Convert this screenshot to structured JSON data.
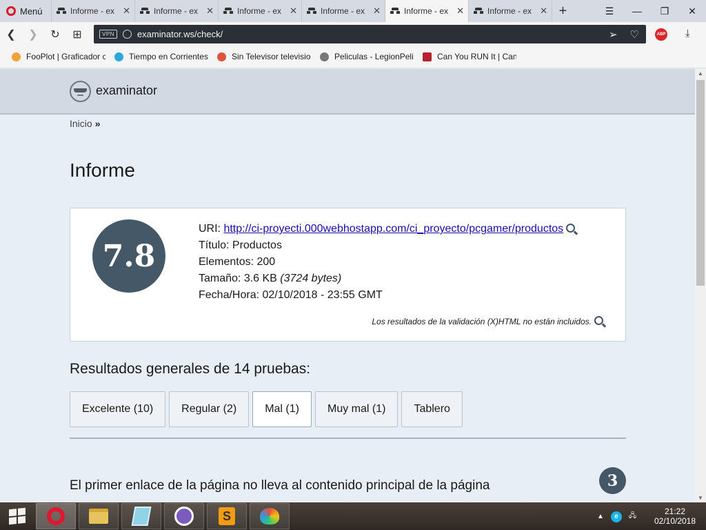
{
  "browser": {
    "menu_label": "Menú",
    "tabs": [
      {
        "label": "Informe - ex"
      },
      {
        "label": "Informe - ex"
      },
      {
        "label": "Informe - ex"
      },
      {
        "label": "Informe - ex"
      },
      {
        "label": "Informe - ex"
      },
      {
        "label": "Informe - ex"
      }
    ],
    "active_tab": 4,
    "url": "examinator.ws/check/",
    "vpn_label": "VPN",
    "abp_label": "ABP",
    "bookmarks": [
      {
        "label": "FooPlot | Graficador c",
        "icon": "fooplot-icon",
        "color": "#f2a23a"
      },
      {
        "label": "Tiempo en Corrientes",
        "icon": "weather-icon",
        "color": "#2ba6de"
      },
      {
        "label": "Sin Televisor televisio",
        "icon": "gear-icon",
        "color": "#e0533d"
      },
      {
        "label": "Peliculas - LegionPeli",
        "icon": "film-reel-icon",
        "color": "#777777"
      },
      {
        "label": "Can You RUN It | Can",
        "icon": "canyourunit-icon",
        "color": "#b8202b"
      }
    ]
  },
  "site": {
    "logo_text": "examinator",
    "breadcrumb": {
      "home": "Inicio",
      "separator": "»"
    },
    "page_title": "Informe",
    "report": {
      "score": "7.8",
      "uri_label": "URI:",
      "uri": "http://ci-proyecti.000webhostapp.com/ci_proyecto/pcgamer/productos",
      "title_line": "Título: Productos",
      "elements_line": "Elementos: 200",
      "size_label": "Tamaño: 3.6 KB",
      "size_bytes": "(3724 bytes)",
      "datetime_line": "Fecha/Hora: 02/10/2018 - 23:55 GMT",
      "validation_note": "Los resultados de la validación (X)HTML no están incluidos."
    },
    "results_title": "Resultados generales de 14 pruebas:",
    "filters": [
      {
        "label": "Excelente (10)"
      },
      {
        "label": "Regular (2)"
      },
      {
        "label": "Mal (1)"
      },
      {
        "label": "Muy mal (1)"
      },
      {
        "label": "Tablero"
      }
    ],
    "active_filter": 2,
    "issue": {
      "title": "El primer enlace de la página no lleva al contenido principal de la página",
      "count": "3"
    }
  },
  "taskbar": {
    "apps": [
      "opera-icon",
      "file-explorer-icon",
      "notepad-icon",
      "cat-app-icon",
      "sublime-text-icon",
      "paint-icon"
    ],
    "sublime_glyph": "S",
    "tray_e": "e",
    "time": "21:22",
    "date": "02/10/2018"
  }
}
